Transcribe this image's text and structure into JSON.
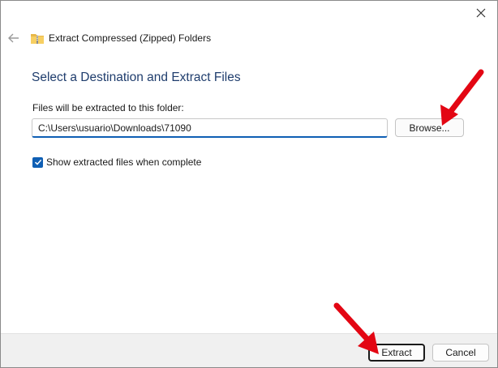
{
  "window": {
    "close_glyph": "✕"
  },
  "header": {
    "back_icon": "back-arrow-icon",
    "folder_icon": "zip-folder-icon",
    "title": "Extract Compressed (Zipped) Folders"
  },
  "main": {
    "heading": "Select a Destination and Extract Files",
    "destination_label": "Files will be extracted to this folder:",
    "destination_value": "C:\\Users\\usuario\\Downloads\\71090",
    "browse_label": "Browse...",
    "show_files_label": "Show extracted files when complete",
    "show_files_checked": true
  },
  "footer": {
    "extract_label": "Extract",
    "cancel_label": "Cancel"
  },
  "colors": {
    "accent": "#0f5fb4",
    "heading": "#1f3d6d",
    "annotation_arrow": "#e30613"
  }
}
